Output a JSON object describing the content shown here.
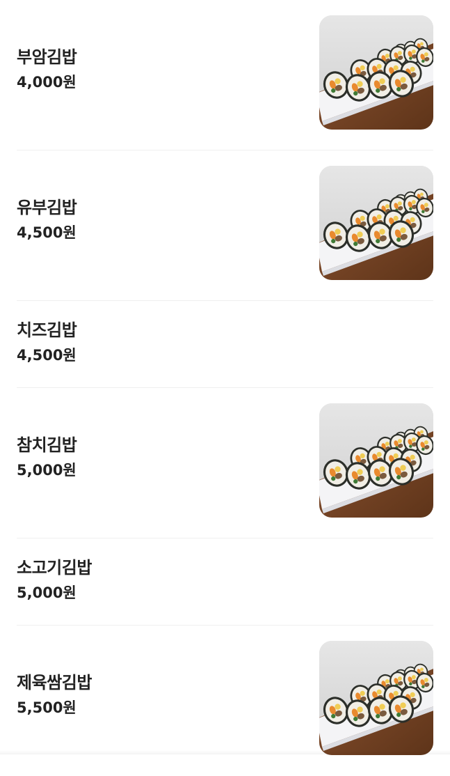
{
  "menu": {
    "items": [
      {
        "name": "부암김밥",
        "price": "4,000원",
        "photo": "bibim-gimbap-photo-icon"
      },
      {
        "name": "유부김밥",
        "price": "4,500원",
        "photo": "yubu-gimbap-photo-icon"
      },
      {
        "name": "치즈김밥",
        "price": "4,500원"
      },
      {
        "name": "참치김밥",
        "price": "5,000원",
        "photo": "tuna-gimbap-photo-icon"
      },
      {
        "name": "소고기김밥",
        "price": "5,000원"
      },
      {
        "name": "제육쌈김밥",
        "price": "5,500원",
        "photo": "jeyuk-gimbap-photo-icon"
      }
    ]
  },
  "colors": {
    "text": "#222222",
    "divider": "#efefef",
    "background": "#ffffff"
  }
}
